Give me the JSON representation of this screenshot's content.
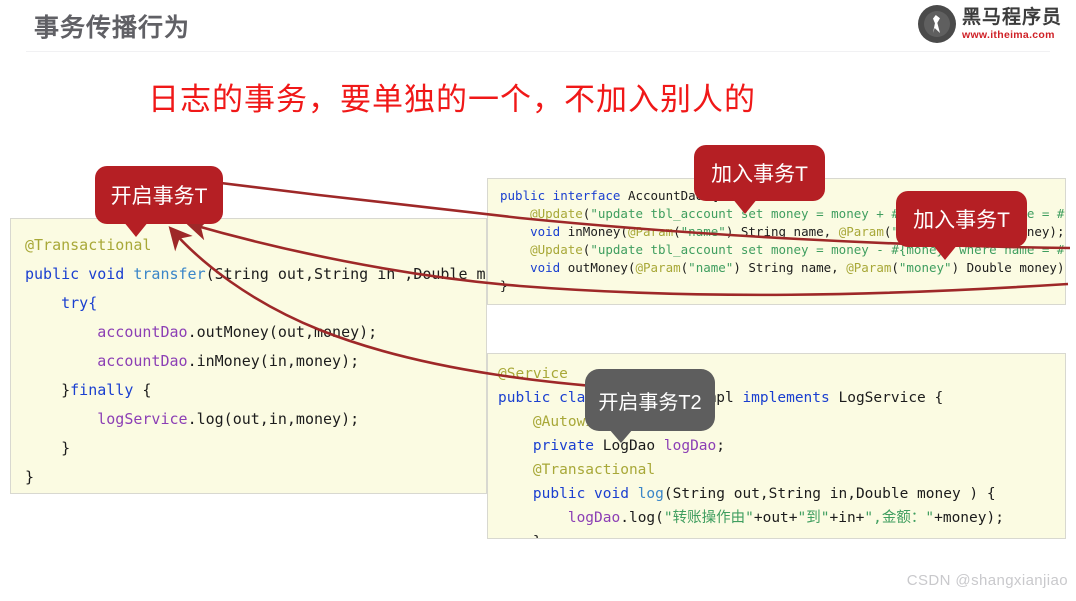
{
  "header": {
    "title": "事务传播行为",
    "divider": true
  },
  "logo": {
    "name": "黑马程序员",
    "url": "www.itheima.com",
    "mark_icon": "horse-circle-icon"
  },
  "headline": {
    "text": "日志的事务，要单独的一个，不加入别人的",
    "color": "#f01818"
  },
  "code_blocks": {
    "transfer": {
      "name": "transfer-service-code",
      "background": "#fbfbe2",
      "lines": [
        [
          {
            "t": "@Transactional",
            "c": "ann"
          }
        ],
        [
          {
            "t": "public ",
            "c": "kw"
          },
          {
            "t": "void ",
            "c": "kw"
          },
          {
            "t": "transfer",
            "c": "fn"
          },
          {
            "t": "(String out,String in ,Double money",
            "c": "txt"
          }
        ],
        [
          {
            "t": "    try{",
            "c": "kw"
          }
        ],
        [
          {
            "t": "        ",
            "c": "txt"
          },
          {
            "t": "accountDao",
            "c": "var"
          },
          {
            "t": ".outMoney(out,money);",
            "c": "txt"
          }
        ],
        [
          {
            "t": "        ",
            "c": "txt"
          },
          {
            "t": "accountDao",
            "c": "var"
          },
          {
            "t": ".inMoney(in,money);",
            "c": "txt"
          }
        ],
        [
          {
            "t": "    }",
            "c": "txt"
          },
          {
            "t": "finally",
            "c": "kw"
          },
          {
            "t": " {",
            "c": "txt"
          }
        ],
        [
          {
            "t": "        ",
            "c": "txt"
          },
          {
            "t": "logService",
            "c": "var"
          },
          {
            "t": ".log(out,in,money);",
            "c": "txt"
          }
        ],
        [
          {
            "t": "    }",
            "c": "txt"
          }
        ],
        [
          {
            "t": "}",
            "c": "txt"
          }
        ]
      ]
    },
    "account_dao": {
      "name": "account-dao-code",
      "background": "#fbfbe2",
      "lines": [
        [
          {
            "t": "public interface ",
            "c": "kw"
          },
          {
            "t": "AccountDao {",
            "c": "txt"
          }
        ],
        [
          {
            "t": "",
            "c": "txt"
          }
        ],
        [
          {
            "t": "    ",
            "c": "txt"
          },
          {
            "t": "@Update",
            "c": "ann"
          },
          {
            "t": "(",
            "c": "txt"
          },
          {
            "t": "\"update tbl_account set money = money + #{money} where name = #{name}\"",
            "c": "str"
          },
          {
            "t": ")",
            "c": "txt"
          }
        ],
        [
          {
            "t": "    ",
            "c": "txt"
          },
          {
            "t": "void ",
            "c": "kw"
          },
          {
            "t": "inMoney(",
            "c": "txt"
          },
          {
            "t": "@Param",
            "c": "ann"
          },
          {
            "t": "(",
            "c": "txt"
          },
          {
            "t": "\"name\"",
            "c": "str"
          },
          {
            "t": ") String name, ",
            "c": "txt"
          },
          {
            "t": "@Param",
            "c": "ann"
          },
          {
            "t": "(",
            "c": "txt"
          },
          {
            "t": "\"money\"",
            "c": "str"
          },
          {
            "t": ") Double money);",
            "c": "txt"
          }
        ],
        [
          {
            "t": "",
            "c": "txt"
          }
        ],
        [
          {
            "t": "    ",
            "c": "txt"
          },
          {
            "t": "@Update",
            "c": "ann"
          },
          {
            "t": "(",
            "c": "txt"
          },
          {
            "t": "\"update tbl_account set money = money - #{money} where name = #{name}\"",
            "c": "str"
          },
          {
            "t": ")",
            "c": "txt"
          }
        ],
        [
          {
            "t": "    ",
            "c": "txt"
          },
          {
            "t": "void ",
            "c": "kw"
          },
          {
            "t": "outMoney(",
            "c": "txt"
          },
          {
            "t": "@Param",
            "c": "ann"
          },
          {
            "t": "(",
            "c": "txt"
          },
          {
            "t": "\"name\"",
            "c": "str"
          },
          {
            "t": ") String name, ",
            "c": "txt"
          },
          {
            "t": "@Param",
            "c": "ann"
          },
          {
            "t": "(",
            "c": "txt"
          },
          {
            "t": "\"money\"",
            "c": "str"
          },
          {
            "t": ") Double money);",
            "c": "txt"
          }
        ],
        [
          {
            "t": "}",
            "c": "txt"
          }
        ]
      ]
    },
    "log_service": {
      "name": "log-service-impl-code",
      "background": "#fbfbe2",
      "lines": [
        [
          {
            "t": "@Service",
            "c": "ann"
          }
        ],
        [
          {
            "t": "public ",
            "c": "kw"
          },
          {
            "t": "class ",
            "c": "kw"
          },
          {
            "t": "LogServiceImpl ",
            "c": "txt"
          },
          {
            "t": "implements ",
            "c": "kw"
          },
          {
            "t": "LogService {",
            "c": "txt"
          }
        ],
        [
          {
            "t": "    ",
            "c": "txt"
          },
          {
            "t": "@Autowired",
            "c": "ann"
          }
        ],
        [
          {
            "t": "    ",
            "c": "txt"
          },
          {
            "t": "private ",
            "c": "kw"
          },
          {
            "t": "LogDao ",
            "c": "txt"
          },
          {
            "t": "logDao",
            "c": "var"
          },
          {
            "t": ";",
            "c": "txt"
          }
        ],
        [
          {
            "t": "    ",
            "c": "txt"
          },
          {
            "t": "@Transactional",
            "c": "ann"
          }
        ],
        [
          {
            "t": "    ",
            "c": "txt"
          },
          {
            "t": "public ",
            "c": "kw"
          },
          {
            "t": "void ",
            "c": "kw"
          },
          {
            "t": "log",
            "c": "fn"
          },
          {
            "t": "(String out,String in,Double money ) {",
            "c": "txt"
          }
        ],
        [
          {
            "t": "        ",
            "c": "txt"
          },
          {
            "t": "logDao",
            "c": "var"
          },
          {
            "t": ".log(",
            "c": "txt"
          },
          {
            "t": "\"转账操作由\"",
            "c": "str"
          },
          {
            "t": "+out+",
            "c": "txt"
          },
          {
            "t": "\"到\"",
            "c": "str"
          },
          {
            "t": "+in+",
            "c": "txt"
          },
          {
            "t": "\",金额：\"",
            "c": "str"
          },
          {
            "t": "+money);",
            "c": "txt"
          }
        ],
        [
          {
            "t": "    }",
            "c": "txt"
          }
        ],
        [
          {
            "t": "}",
            "c": "txt"
          }
        ]
      ]
    }
  },
  "callouts": {
    "open_t": {
      "label": "开启事务T",
      "color": "#b51f24"
    },
    "join_t_1": {
      "label": "加入事务T",
      "color": "#b51f24"
    },
    "join_t_2": {
      "label": "加入事务T",
      "color": "#b51f24"
    },
    "open_t2": {
      "label": "开启事务T2",
      "color": "#5e5e5e"
    }
  },
  "arrows": {
    "color": "#9e2828",
    "count": 3,
    "descriptions": [
      "from-account-dao-inMoney-to-open-t-callout",
      "from-account-dao-outMoney-to-open-t-callout",
      "from-log-service-to-open-t-callout"
    ]
  },
  "watermark": {
    "text": "CSDN @shangxianjiao"
  }
}
